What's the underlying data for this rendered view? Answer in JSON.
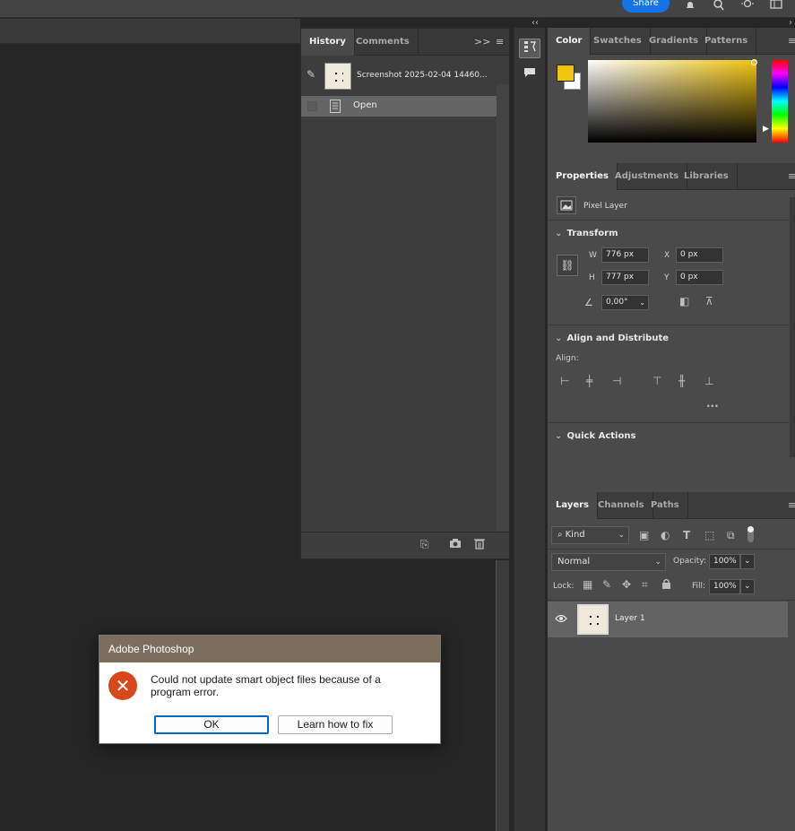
{
  "topbar": {
    "share_label": "Share"
  },
  "history": {
    "tabs": [
      "History",
      "Comments"
    ],
    "snapshot_name": "Screenshot 2025-02-04 14460...",
    "states": [
      {
        "label": "Open"
      }
    ]
  },
  "color_panel": {
    "tabs": [
      "Color",
      "Swatches",
      "Gradients",
      "Patterns"
    ],
    "foreground_color": "#f1c40f",
    "background_color": "#ffffff"
  },
  "properties": {
    "tabs": [
      "Properties",
      "Adjustments",
      "Libraries"
    ],
    "layer_type": "Pixel Layer",
    "transform": {
      "title": "Transform",
      "w_label": "W",
      "w_value": "776 px",
      "h_label": "H",
      "h_value": "777 px",
      "x_label": "X",
      "x_value": "0 px",
      "y_label": "Y",
      "y_value": "0 px",
      "angle_value": "0,00°"
    },
    "align": {
      "title": "Align and Distribute",
      "align_label": "Align:"
    },
    "quick_actions": {
      "title": "Quick Actions"
    }
  },
  "layers": {
    "tabs": [
      "Layers",
      "Channels",
      "Paths"
    ],
    "filter_kind": "Kind",
    "blend_mode": "Normal",
    "opacity_label": "Opacity:",
    "opacity_value": "100%",
    "lock_label": "Lock:",
    "fill_label": "Fill:",
    "fill_value": "100%",
    "items": [
      {
        "name": "Layer 1",
        "visible": true
      }
    ]
  },
  "dialog": {
    "title": "Adobe Photoshop",
    "message": "Could not update smart object files because of a program error.",
    "ok_label": "OK",
    "learn_label": "Learn how to fix"
  }
}
